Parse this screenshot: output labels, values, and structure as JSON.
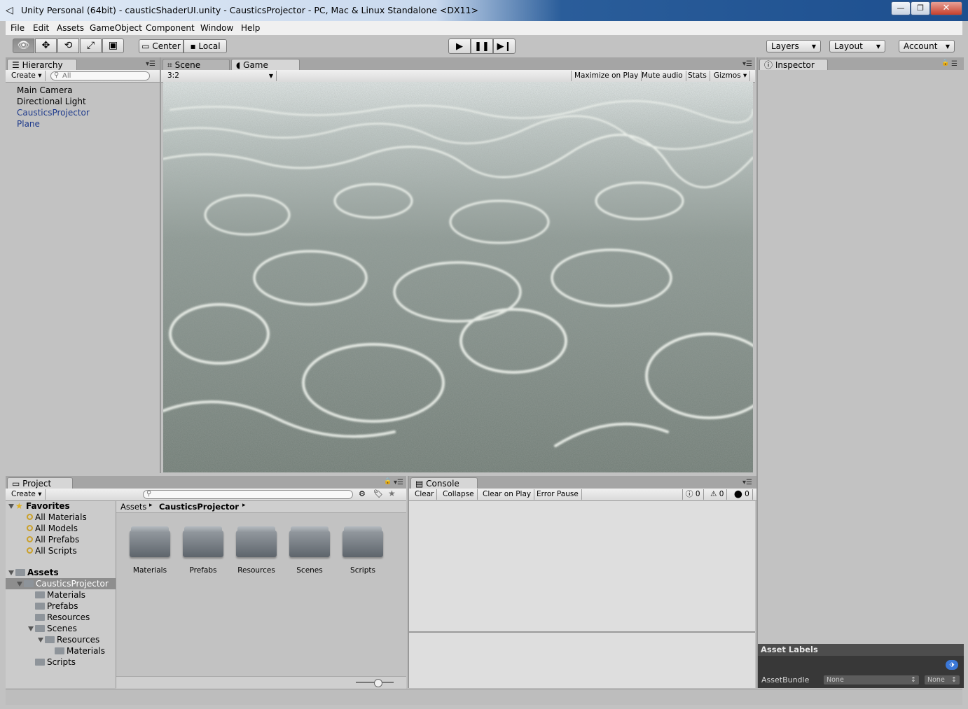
{
  "window": {
    "title": "Unity Personal (64bit) - causticShaderUI.unity - CausticsProjector - PC, Mac & Linux Standalone <DX11>",
    "controls": {
      "minimize": "—",
      "maximize": "❐",
      "close": "✕"
    }
  },
  "menu": [
    "File",
    "Edit",
    "Assets",
    "GameObject",
    "Component",
    "Window",
    "Help"
  ],
  "toolbar": {
    "tools": [
      "view-tool",
      "move-tool",
      "rotate-tool",
      "scale-tool",
      "rect-tool"
    ],
    "pivot_label": "Center",
    "space_label": "Local",
    "layers_label": "Layers",
    "layout_label": "Layout",
    "account_label": "Account"
  },
  "hierarchy": {
    "tab_label": "Hierarchy",
    "create_label": "Create",
    "search_placeholder": "All",
    "items": [
      {
        "label": "Main Camera",
        "color": "#000000"
      },
      {
        "label": "Directional Light",
        "color": "#000000"
      },
      {
        "label": "CausticsProjector",
        "color": "#1e3a8c"
      },
      {
        "label": "Plane",
        "color": "#1e3a8c"
      }
    ]
  },
  "scene_tab": {
    "label": "Scene"
  },
  "game": {
    "tab_label": "Game",
    "aspect": "3:2",
    "buttons": [
      "Maximize on Play",
      "Mute audio",
      "Stats",
      "Gizmos"
    ]
  },
  "inspector": {
    "tab_label": "Inspector",
    "asset_labels_title": "Asset Labels",
    "assetbundle_label": "AssetBundle",
    "assetbundle_value": "None",
    "variant_value": "None"
  },
  "project": {
    "tab_label": "Project",
    "create_label": "Create",
    "breadcrumb": [
      "Assets",
      "CausticsProjector"
    ],
    "favorites_label": "Favorites",
    "favorites": [
      "All Materials",
      "All Models",
      "All Prefabs",
      "All Scripts"
    ],
    "assets_label": "Assets",
    "tree": [
      {
        "label": "CausticsProjector",
        "depth": 1,
        "expanded": true
      },
      {
        "label": "Materials",
        "depth": 2
      },
      {
        "label": "Prefabs",
        "depth": 2
      },
      {
        "label": "Resources",
        "depth": 2
      },
      {
        "label": "Scenes",
        "depth": 2,
        "expanded": true
      },
      {
        "label": "Resources",
        "depth": 3,
        "expanded": true
      },
      {
        "label": "Materials",
        "depth": 4
      },
      {
        "label": "Scripts",
        "depth": 2
      }
    ],
    "folders": [
      "Materials",
      "Prefabs",
      "Resources",
      "Scenes",
      "Scripts"
    ]
  },
  "console": {
    "tab_label": "Console",
    "buttons": [
      "Clear",
      "Collapse",
      "Clear on Play",
      "Error Pause"
    ],
    "info_count": "0",
    "warning_count": "0",
    "error_count": "0"
  }
}
